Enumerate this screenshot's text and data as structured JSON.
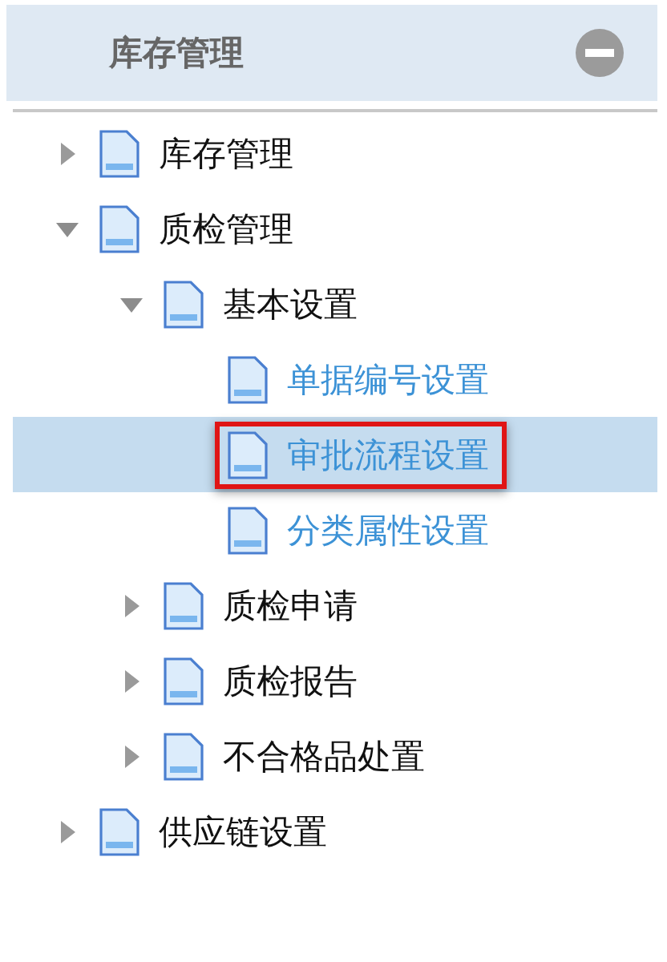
{
  "panel": {
    "title": "库存管理",
    "collapsed": false
  },
  "tree": [
    {
      "label": "库存管理",
      "expanded": false,
      "selected": false,
      "marked": false
    },
    {
      "label": "质检管理",
      "expanded": true,
      "selected": false,
      "marked": false,
      "children": [
        {
          "label": "基本设置",
          "expanded": true,
          "selected": false,
          "marked": false,
          "children": [
            {
              "label": "单据编号设置",
              "selected": false,
              "marked": false
            },
            {
              "label": "审批流程设置",
              "selected": true,
              "marked": true
            },
            {
              "label": "分类属性设置",
              "selected": false,
              "marked": false
            }
          ]
        },
        {
          "label": "质检申请",
          "expanded": false,
          "selected": false,
          "marked": false
        },
        {
          "label": "质检报告",
          "expanded": false,
          "selected": false,
          "marked": false
        },
        {
          "label": "不合格品处置",
          "expanded": false,
          "selected": false,
          "marked": false
        }
      ]
    },
    {
      "label": "供应链设置",
      "expanded": false,
      "selected": false,
      "marked": false
    }
  ]
}
